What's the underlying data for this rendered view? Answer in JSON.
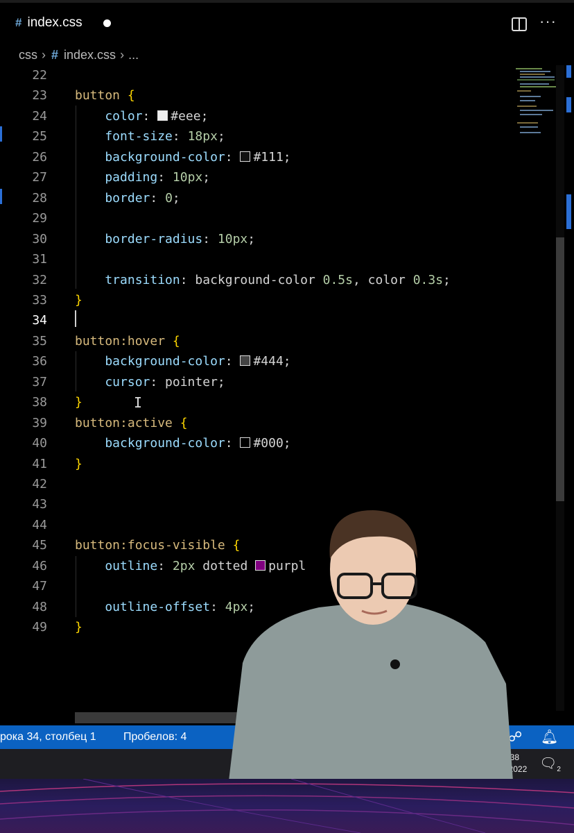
{
  "tab": {
    "filename": "index.css"
  },
  "breadcrumb": {
    "folder": "css",
    "file": "index.css",
    "more": "..."
  },
  "code_lines": [
    {
      "n": "22",
      "parts": []
    },
    {
      "n": "23",
      "parts": [
        [
          "sel",
          "button "
        ],
        [
          "brace",
          "{"
        ]
      ]
    },
    {
      "n": "24",
      "parts": [
        [
          "prop",
          "    color"
        ],
        [
          "val",
          ": "
        ],
        [
          "swatch",
          "#eeeeee"
        ],
        [
          "val",
          "#eee;"
        ]
      ]
    },
    {
      "n": "25",
      "parts": [
        [
          "prop",
          "    font-size"
        ],
        [
          "val",
          ": "
        ],
        [
          "num",
          "18px"
        ],
        [
          "val",
          ";"
        ]
      ]
    },
    {
      "n": "26",
      "parts": [
        [
          "prop",
          "    background-color"
        ],
        [
          "val",
          ": "
        ],
        [
          "swatch",
          "#111111"
        ],
        [
          "val",
          "#111;"
        ]
      ]
    },
    {
      "n": "27",
      "parts": [
        [
          "prop",
          "    padding"
        ],
        [
          "val",
          ": "
        ],
        [
          "num",
          "10px"
        ],
        [
          "val",
          ";"
        ]
      ]
    },
    {
      "n": "28",
      "parts": [
        [
          "prop",
          "    border"
        ],
        [
          "val",
          ": "
        ],
        [
          "num",
          "0"
        ],
        [
          "val",
          ";"
        ]
      ]
    },
    {
      "n": "29",
      "parts": []
    },
    {
      "n": "30",
      "parts": [
        [
          "prop",
          "    border-radius"
        ],
        [
          "val",
          ": "
        ],
        [
          "num",
          "10px"
        ],
        [
          "val",
          ";"
        ]
      ]
    },
    {
      "n": "31",
      "parts": []
    },
    {
      "n": "32",
      "parts": [
        [
          "prop",
          "    transition"
        ],
        [
          "val",
          ": background-color "
        ],
        [
          "num",
          "0.5s"
        ],
        [
          "val",
          ", color "
        ],
        [
          "num",
          "0.3s"
        ],
        [
          "val",
          ";"
        ]
      ]
    },
    {
      "n": "33",
      "parts": [
        [
          "brace",
          "}"
        ]
      ]
    },
    {
      "n": "34",
      "parts": []
    },
    {
      "n": "35",
      "parts": [
        [
          "sel",
          "button:hover "
        ],
        [
          "brace",
          "{"
        ]
      ]
    },
    {
      "n": "36",
      "parts": [
        [
          "prop",
          "    background-color"
        ],
        [
          "val",
          ": "
        ],
        [
          "swatch",
          "#444444"
        ],
        [
          "val",
          "#444;"
        ]
      ]
    },
    {
      "n": "37",
      "parts": [
        [
          "prop",
          "    cursor"
        ],
        [
          "val",
          ": pointer;"
        ]
      ]
    },
    {
      "n": "38",
      "parts": [
        [
          "brace",
          "}"
        ]
      ]
    },
    {
      "n": "39",
      "parts": [
        [
          "sel",
          "button:active "
        ],
        [
          "brace",
          "{"
        ]
      ]
    },
    {
      "n": "40",
      "parts": [
        [
          "prop",
          "    background-color"
        ],
        [
          "val",
          ": "
        ],
        [
          "swatch",
          "#000000"
        ],
        [
          "val",
          "#000;"
        ]
      ]
    },
    {
      "n": "41",
      "parts": [
        [
          "brace",
          "}"
        ]
      ]
    },
    {
      "n": "42",
      "parts": []
    },
    {
      "n": "43",
      "parts": []
    },
    {
      "n": "44",
      "parts": []
    },
    {
      "n": "45",
      "parts": [
        [
          "sel",
          "button:focus-visible "
        ],
        [
          "brace",
          "{"
        ]
      ]
    },
    {
      "n": "46",
      "parts": [
        [
          "prop",
          "    outline"
        ],
        [
          "val",
          ": "
        ],
        [
          "num",
          "2px"
        ],
        [
          "val",
          " dotted "
        ],
        [
          "swatch",
          "#800080"
        ],
        [
          "val",
          "purpl"
        ]
      ]
    },
    {
      "n": "47",
      "parts": []
    },
    {
      "n": "48",
      "parts": [
        [
          "prop",
          "    outline-offset"
        ],
        [
          "val",
          ": "
        ],
        [
          "num",
          "4px"
        ],
        [
          "val",
          ";"
        ]
      ]
    },
    {
      "n": "49",
      "parts": [
        [
          "brace",
          "}"
        ]
      ]
    }
  ],
  "active_line": "34",
  "status": {
    "position": "рока 34, столбец 1",
    "spaces": "Пробелов: 4"
  },
  "taskbar": {
    "time": "16:38",
    "date": "9.11.2022",
    "notification_count": "2"
  },
  "colors": {
    "statusbar": "#0b62c2",
    "selector": "#d7ba7d",
    "property": "#9cdcfe",
    "number": "#b5cea8",
    "brace": "#ffd700",
    "presenter_sweater": "#8e9b9a"
  },
  "icons": [
    "file-hash-icon",
    "unsaved-dot-icon",
    "split-editor-icon",
    "more-actions-icon",
    "feedback-icon",
    "bell-icon",
    "notifications-icon"
  ]
}
